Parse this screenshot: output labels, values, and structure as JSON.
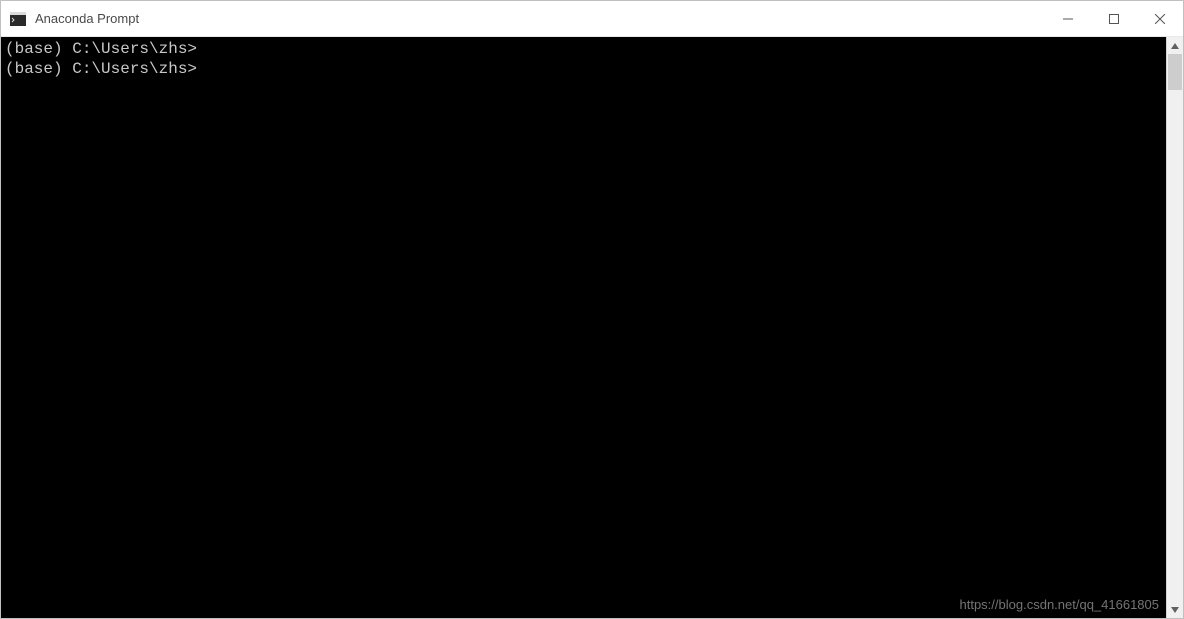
{
  "window": {
    "title": "Anaconda Prompt"
  },
  "terminal": {
    "lines": [
      "(base) C:\\Users\\zhs>",
      "(base) C:\\Users\\zhs>"
    ]
  },
  "watermark": "https://blog.csdn.net/qq_41661805"
}
